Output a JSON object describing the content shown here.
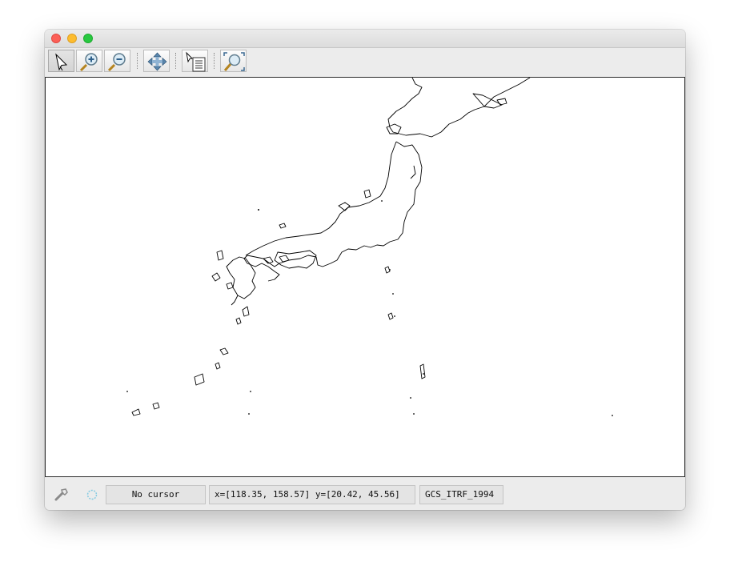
{
  "window": {
    "traffic_lights": [
      "close",
      "minimize",
      "zoom"
    ]
  },
  "toolbar": {
    "tools": [
      {
        "name": "select-tool",
        "icon": "arrow-pointer-icon",
        "active": true
      },
      {
        "name": "zoom-in-tool",
        "icon": "zoom-in-icon",
        "active": false
      },
      {
        "name": "zoom-out-tool",
        "icon": "zoom-out-icon",
        "active": false
      },
      {
        "name": "pan-tool",
        "icon": "pan-arrows-icon",
        "active": false
      },
      {
        "name": "identify-tool",
        "icon": "identify-info-icon",
        "active": false
      },
      {
        "name": "full-extent-tool",
        "icon": "full-extent-icon",
        "active": false
      }
    ]
  },
  "map": {
    "layer_features": [
      "Japan coastline outline",
      "offshore islands"
    ],
    "outline_color": "#000000",
    "background_color": "#ffffff"
  },
  "statusbar": {
    "cursor_label": "No cursor",
    "extent_label": "x=[118.35, 158.57] y=[20.42, 45.56]",
    "crs_label": "GCS_ITRF_1994",
    "icons": [
      "wrench-icon",
      "refresh-spinner-icon"
    ]
  }
}
